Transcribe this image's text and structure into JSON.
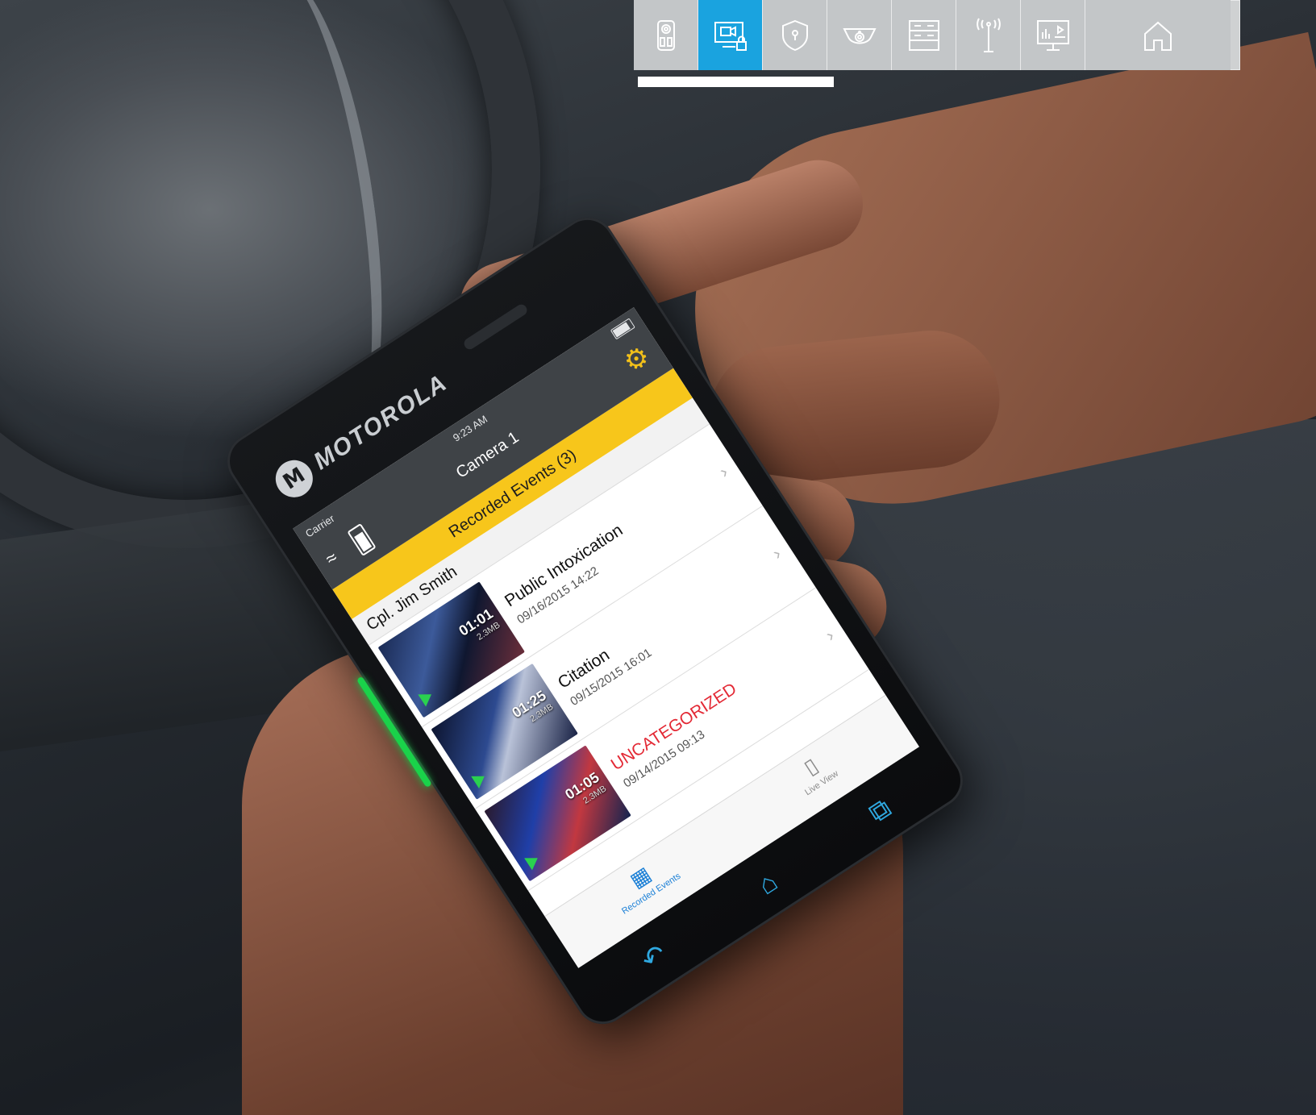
{
  "nav": {
    "items": [
      {
        "icon": "body-camera-icon",
        "active": false
      },
      {
        "icon": "secure-video-icon",
        "active": true
      },
      {
        "icon": "security-shield-icon",
        "active": false
      },
      {
        "icon": "dome-camera-icon",
        "active": false
      },
      {
        "icon": "server-rack-icon",
        "active": false
      },
      {
        "icon": "radio-tower-icon",
        "active": false
      },
      {
        "icon": "analytics-monitor-icon",
        "active": false
      },
      {
        "icon": "home-icon",
        "active": false
      }
    ],
    "active_color": "#1aa3df",
    "inactive_color": "#c3c6c8"
  },
  "phone": {
    "brand": "MOTOROLA",
    "status": {
      "carrier": "Carrier",
      "time": "9:23 AM",
      "camera": "Camera 1"
    },
    "events_header": "Recorded Events (3)",
    "officer": "Cpl. Jim Smith",
    "events": [
      {
        "title": "Public Intoxication",
        "date": "09/16/2015 14:22",
        "duration": "01:01",
        "size": "2.3MB",
        "highlight": false
      },
      {
        "title": "Citation",
        "date": "09/15/2015 16:01",
        "duration": "01:25",
        "size": "2.3MB",
        "highlight": false
      },
      {
        "title": "UNCATEGORIZED",
        "date": "09/14/2015 09:13",
        "duration": "01:05",
        "size": "2.3MB",
        "highlight": true
      }
    ],
    "tabs": [
      {
        "label": "Recorded Events",
        "icon": "recorded-events-icon",
        "active": true
      },
      {
        "label": "Live View",
        "icon": "live-view-icon",
        "active": false
      }
    ],
    "accent": "#f7c61b",
    "alert_color": "#e32935"
  }
}
